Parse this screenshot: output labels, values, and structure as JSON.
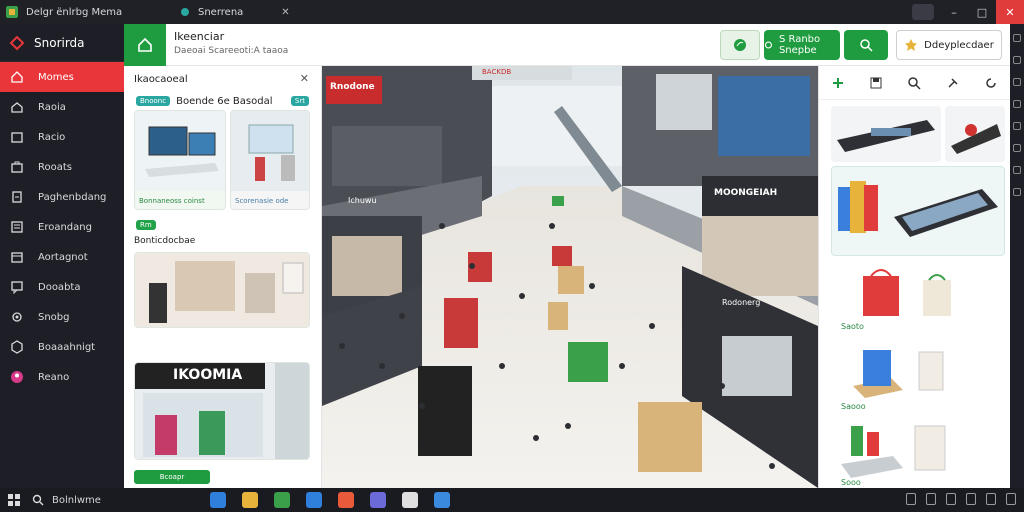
{
  "window": {
    "title": "Delgr ënlrbg Mema",
    "tab_label": "Snerrena",
    "minimize": "–",
    "maximize": "□",
    "close": "✕"
  },
  "sidebar": {
    "brand": "Snorirda",
    "items": [
      {
        "label": "Momes",
        "icon": "home-icon",
        "active": true
      },
      {
        "label": "Raoia",
        "icon": "house-icon"
      },
      {
        "label": "Racio",
        "icon": "folder-icon"
      },
      {
        "label": "Rooats",
        "icon": "briefcase-icon"
      },
      {
        "label": "Paghenbdang",
        "icon": "document-icon"
      },
      {
        "label": "Eroandang",
        "icon": "list-icon"
      },
      {
        "label": "Aortagnot",
        "icon": "calendar-icon"
      },
      {
        "label": "Dooabta",
        "icon": "chat-icon"
      },
      {
        "label": "Snobg",
        "icon": "gear-icon"
      },
      {
        "label": "Boaaahnigt",
        "icon": "grid-icon"
      },
      {
        "label": "Reano",
        "icon": "avatar-icon"
      }
    ]
  },
  "header": {
    "title": "Ikeenciar",
    "subtitle": "Daeoai Scareeoti:A taaoa",
    "buttons": [
      {
        "label": "",
        "icon": "leaf-icon"
      },
      {
        "label": "S Ranbo Snepbe",
        "icon": "settings-icon"
      },
      {
        "label": "",
        "icon": "search-icon"
      },
      {
        "label": "Ddeyplecdaer",
        "icon": "star-icon"
      }
    ]
  },
  "left_panel": {
    "title": "Ikaocaoeal",
    "close": "✕",
    "section1": {
      "tag": "Bnoonc",
      "title": "Boende 6e Basodal",
      "badge": "Srt"
    },
    "cards": [
      {
        "caption": "Bonnaneoss coinst"
      },
      {
        "caption": "Scorenasie ode"
      }
    ],
    "section2": {
      "tag": "Rm",
      "title": "Bonticdocbae"
    },
    "store_sign": "IKOOMIA",
    "bottom_button": "Bcoapr"
  },
  "mall": {
    "signs": [
      "Rnodone",
      "BACKDB",
      "Ichuwu",
      "MOONGEIAH",
      "Rodonerg"
    ]
  },
  "right_panel": {
    "tools": [
      "plus-icon",
      "save-icon",
      "search-icon",
      "pin-icon",
      "refresh-icon"
    ],
    "captions": [
      "Saoto",
      "Saooo",
      "Sooo"
    ]
  },
  "taskbar": {
    "search": "Bolnlwme",
    "apps": [
      "#2f7fdd",
      "#e8b33a",
      "#3aa04a",
      "#2f7fdd",
      "#e85a3a",
      "#6a6ad8",
      "#e0e0e0",
      "#3a8ae0"
    ]
  },
  "colors": {
    "accent_red": "#e8363a",
    "accent_green": "#1f9c3f",
    "teal": "#29a7a0"
  }
}
